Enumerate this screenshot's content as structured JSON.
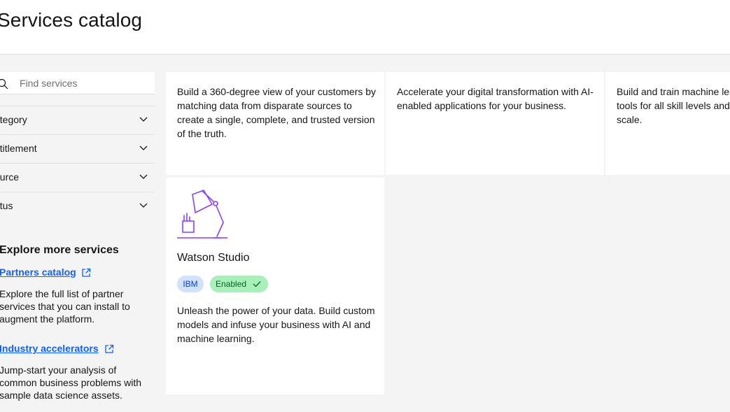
{
  "header": {
    "title": "Services catalog"
  },
  "sidebar": {
    "search_placeholder": "Find services",
    "filters": [
      {
        "label": "ategory"
      },
      {
        "label": "ntitlement"
      },
      {
        "label": "ource"
      },
      {
        "label": "atus"
      }
    ],
    "explore": {
      "title": "Explore more services",
      "links": [
        {
          "label": "Partners catalog",
          "description": "Explore the full list of partner services that you can install to augment the platform."
        },
        {
          "label": "Industry accelerators",
          "description": "Jump-start your analysis of common business problems with sample data science assets."
        }
      ]
    }
  },
  "cards": [
    {
      "description": "Build a 360-degree view of your customers by matching data from disparate sources to create a single, complete, and trusted version of the truth."
    },
    {
      "description": "Accelerate your digital transformation with AI-enabled applications for your business."
    },
    {
      "description": "Build and train machine learning models with tools for all skill levels and manage models at scale."
    },
    {
      "icon": "desk-lamp-icon",
      "title": "Watson Studio",
      "tags": [
        "IBM",
        "Enabled"
      ],
      "description": "Unleash the power of your data. Build custom models and infuse your business with AI and machine learning."
    }
  ],
  "colors": {
    "link": "#0f62fe",
    "accent_icon": "#8a3ffc",
    "tag_blue": "#d0e2ff",
    "tag_green": "#a7f0ba"
  }
}
